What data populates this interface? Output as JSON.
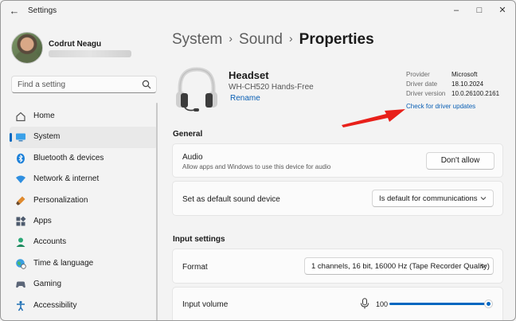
{
  "window": {
    "title": "Settings",
    "controls": [
      "minimize",
      "maximize",
      "close"
    ]
  },
  "profile": {
    "name": "Codrut Neagu"
  },
  "search": {
    "placeholder": "Find a setting"
  },
  "sidebar": {
    "items": [
      {
        "label": "Home",
        "icon": "home-icon",
        "active": false
      },
      {
        "label": "System",
        "icon": "system-icon",
        "active": true
      },
      {
        "label": "Bluetooth & devices",
        "icon": "bluetooth-icon",
        "active": false
      },
      {
        "label": "Network & internet",
        "icon": "network-icon",
        "active": false
      },
      {
        "label": "Personalization",
        "icon": "brush-icon",
        "active": false
      },
      {
        "label": "Apps",
        "icon": "apps-icon",
        "active": false
      },
      {
        "label": "Accounts",
        "icon": "accounts-icon",
        "active": false
      },
      {
        "label": "Time & language",
        "icon": "globe-clock-icon",
        "active": false
      },
      {
        "label": "Gaming",
        "icon": "gamepad-icon",
        "active": false
      },
      {
        "label": "Accessibility",
        "icon": "accessibility-icon",
        "active": false
      }
    ]
  },
  "breadcrumb": {
    "items": [
      "System",
      "Sound"
    ],
    "current": "Properties",
    "separator": "›"
  },
  "device": {
    "name": "Headset",
    "model": "WH-CH520 Hands-Free",
    "rename_label": "Rename",
    "icon": "headset-icon"
  },
  "driver": {
    "rows": [
      {
        "key": "Provider",
        "value": "Microsoft"
      },
      {
        "key": "Driver date",
        "value": "18.10.2024"
      },
      {
        "key": "Driver version",
        "value": "10.0.26100.2161"
      }
    ],
    "link": "Check for driver updates"
  },
  "general": {
    "title": "General",
    "audio": {
      "title": "Audio",
      "subtitle": "Allow apps and Windows to use this device for audio",
      "button": "Don't allow"
    },
    "default_device": {
      "title": "Set as default sound device",
      "value": "Is default for communications"
    }
  },
  "input_settings": {
    "title": "Input settings",
    "format": {
      "title": "Format",
      "value": "1 channels, 16 bit, 16000 Hz (Tape Recorder Quality)"
    },
    "volume": {
      "title": "Input volume",
      "value": "100",
      "level": 1.0,
      "icon": "microphone-icon"
    }
  },
  "colors": {
    "accent": "#0067c0",
    "link": "#0a5fb4",
    "annotation_arrow": "#e8201a"
  }
}
